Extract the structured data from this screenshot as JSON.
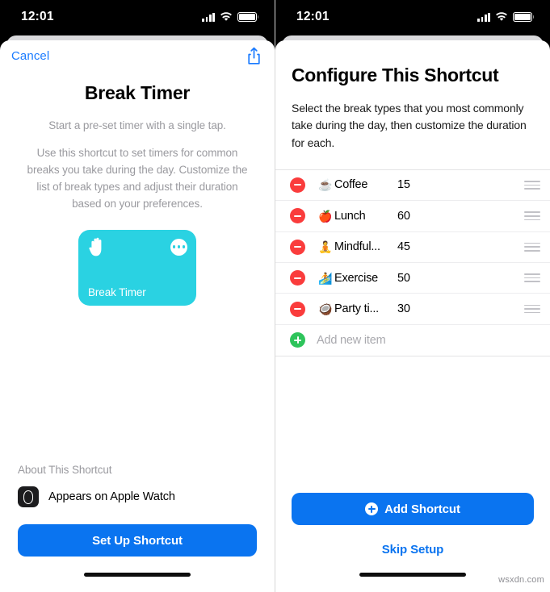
{
  "status_bar": {
    "time": "12:01",
    "icons": [
      "cellular-signal-icon",
      "wifi-icon",
      "battery-icon"
    ]
  },
  "left_screen": {
    "topbar": {
      "cancel_label": "Cancel",
      "share_icon": "share-icon"
    },
    "title": "Break Timer",
    "subtitle": "Start a pre-set timer with a single tap.",
    "description": "Use this shortcut to set timers for common breaks you take during the day. Customize the list of break types and adjust their duration based on your preferences.",
    "card": {
      "label": "Break Timer",
      "color": "#2ad2e2",
      "glyph_icon": "raised-hand-icon",
      "menu_icon": "ellipsis-icon"
    },
    "about": {
      "heading": "About This Shortcut",
      "item_icon": "apple-watch-icon",
      "item_label": "Appears on Apple Watch"
    },
    "primary_button": "Set Up Shortcut"
  },
  "right_screen": {
    "title": "Configure This Shortcut",
    "intro": "Select the break types that you most commonly take during the day, then customize the duration for each.",
    "list": {
      "rows": [
        {
          "emoji": "☕",
          "emoji_name": "coffee-emoji",
          "label": "Coffee",
          "value": "15"
        },
        {
          "emoji": "🍎",
          "emoji_name": "apple-emoji",
          "label": "Lunch",
          "value": "60"
        },
        {
          "emoji": "🧘",
          "emoji_name": "meditation-emoji",
          "label": "Mindful...",
          "value": "45"
        },
        {
          "emoji": "🏄",
          "emoji_name": "exercise-emoji",
          "label": "Exercise",
          "value": "50"
        },
        {
          "emoji": "🥥",
          "emoji_name": "coconut-drink-emoji",
          "label": "Party ti...",
          "value": "30"
        }
      ],
      "add_row_label": "Add new item",
      "remove_icon": "minus-circle-icon",
      "add_icon": "plus-circle-icon",
      "reorder_icon": "drag-handle-icon",
      "remove_color": "#fa3c3c",
      "add_color": "#2ec45b"
    },
    "primary_button": "Add Shortcut",
    "primary_button_icon": "plus-circle-icon",
    "secondary_link": "Skip Setup"
  },
  "theme": {
    "accent_blue": "#0a74f0",
    "link_blue": "#1a7bff"
  },
  "watermark": "wsxdn.com"
}
